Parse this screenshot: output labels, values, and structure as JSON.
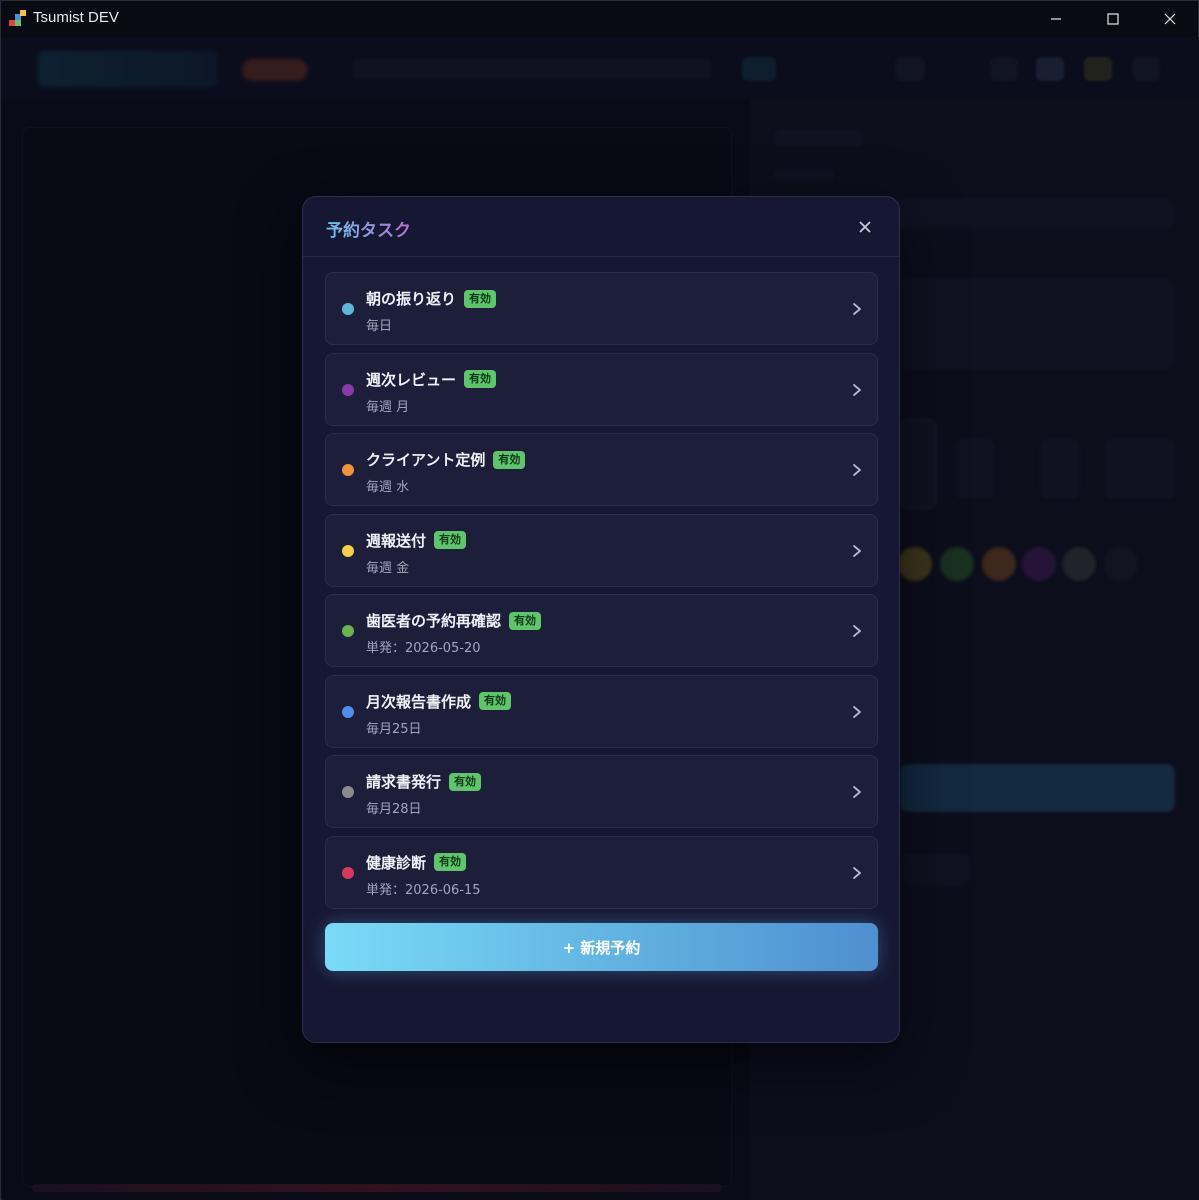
{
  "window": {
    "title": "Tsumist DEV",
    "icon": "app-logo-icon"
  },
  "modal": {
    "title": "予約タスク",
    "close_icon": "close-icon",
    "tasks": [
      {
        "name": "朝の振り返り",
        "badge": "有効",
        "schedule": "毎日",
        "color": "#5fb8dc"
      },
      {
        "name": "週次レビュー",
        "badge": "有効",
        "schedule": "毎週 月",
        "color": "#8a3aa8"
      },
      {
        "name": "クライアント定例",
        "badge": "有効",
        "schedule": "毎週 水",
        "color": "#f0923a"
      },
      {
        "name": "週報送付",
        "badge": "有効",
        "schedule": "毎週 金",
        "color": "#f3cf4a"
      },
      {
        "name": "歯医者の予約再確認",
        "badge": "有効",
        "schedule": "単発：2026-05-20",
        "color": "#6db24e"
      },
      {
        "name": "月次報告書作成",
        "badge": "有効",
        "schedule": "毎月25日",
        "color": "#4f8ee6"
      },
      {
        "name": "請求書発行",
        "badge": "有効",
        "schedule": "毎月28日",
        "color": "#8a8a8e"
      },
      {
        "name": "健康診断",
        "badge": "有効",
        "schedule": "単発：2026-06-15",
        "color": "#d8375e"
      }
    ],
    "new_button_label": "+ 新規予約"
  },
  "colors": {
    "accent_gradient_start": "#79dbf6",
    "accent_gradient_end": "#4e8fd0",
    "badge_green": "#5fc46c",
    "modal_bg": "#161733"
  }
}
